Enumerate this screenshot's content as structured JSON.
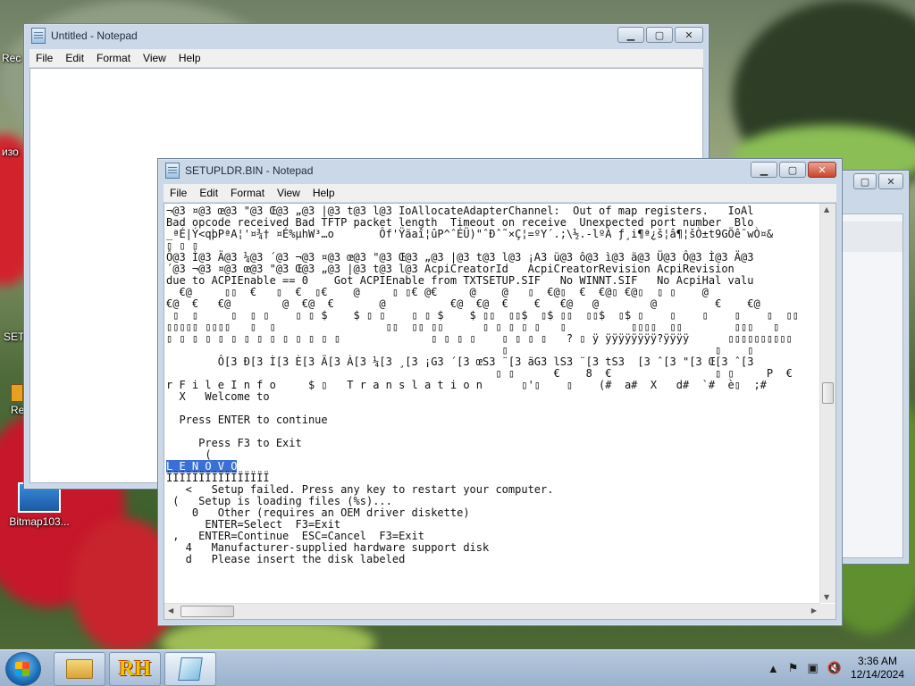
{
  "desktop": {
    "icons": [
      {
        "label": "Rec"
      },
      {
        "label": "изо"
      },
      {
        "label": "SET"
      },
      {
        "label": "Re"
      },
      {
        "label": "Bitmap103..."
      }
    ]
  },
  "notepad_back": {
    "title": "Untitled - Notepad",
    "menu": [
      "File",
      "Edit",
      "Format",
      "View",
      "Help"
    ]
  },
  "notepad_front": {
    "title": "SETUPLDR.BIN - Notepad",
    "menu": [
      "File",
      "Edit",
      "Format",
      "View",
      "Help"
    ],
    "lines": [
      "¬@3 ¤@3 œ@3 \"@3 Œ@3 „@3 |@3 t@3 l@3 IoAllocateAdapterChannel:  Out of map registers.   IoAl",
      "Bad opcode received Bad TFTP packet length  Timeout on receive  Unexpected port number  Blo",
      "_ªÉ|Ý<qþPªA¦'¤¾† ¤É%µhW³…o       Ôf'Ÿäaî¦ûP^ˆÉÜ)\"ˆÐˆ˜×Ç¦=ºY´.;\\½.-lºÀ ƒ¸i¶ª¿š¦â¶¦šÒ±t9GÖê¯wÒ¤&",
      "▯ ▯ ▯",
      "Ô@3 Ì@3 Ä@3 ¼@3 ´@3 ¬@3 ¤@3 œ@3 \"@3 Œ@3 „@3 |@3 t@3 l@3 ¡A3 ü@3 ô@3 ì@3 ä@3 Ü@3 Ô@3 Ì@3 Ä@3",
      "´@3 ¬@3 ¤@3 œ@3 \"@3 Œ@3 „@3 |@3 t@3 l@3 AcpiCreatorId   AcpiCreatorRevision AcpiRevision",
      "due to ACPIEnable == 0    Got ACPIEnable from TXTSETUP.SIF   No WINNT.SIF   No AcpiHal valu",
      "  €@     ▯▯  €   ▯  €  ▯€    @     ▯ ▯€ @€     @    @   ▯  €@▯  €  €@▯ €@▯  ▯ ▯    @",
      "€@  €   €@        @  €@  €       @          €@  €@  €    €   €@   @        @         €    €@",
      " ▯  ▯     ▯  ▯ ▯    ▯ ▯ $    $ ▯ ▯    ▯ ▯ $    $ ▯▯  ▯▯$  ▯$ ▯▯  ▯▯$  ▯$ ▯    ▯    ▯    ▯    ▯  ▯▯",
      "▯▯▯▯▯ ▯▯▯▯   ▯  ▯                 ▯▯  ▯▯ ▯▯      ▯ ▯ ▯ ▯ ▯   ▯          ▯▯▯▯  ▯▯        ▯▯▯   ▯",
      "▯ ▯ ▯ ▯ ▯ ▯ ▯ ▯ ▯ ▯ ▯ ▯ ▯ ▯              ▯ ▯ ▯ ▯    ▯ ▯ ▯ ▯   ? ▯ ÿ ÿÿÿÿÿÿÿÿ?ÿÿÿÿ      ▯▯▯▯▯▯▯▯▯▯",
      "                                                    ▯                                ▯    ▯",
      "        Ô[3 Ð[3 Ì[3 È[3 Ä[3 À[3 ¼[3 ¸[3 ¡G3 ´[3 œS3 ¨[3 äG3 lS3 ¨[3 tS3  [3 ˆ[3 \"[3 Œ[3 ˆ[3",
      "                                                   ▯ ▯      €    8  €                ▯ ▯     P  €",
      "r F i l e I n f o     $ ▯   T r a n s l a t i o n      ▯'▯    ▯    (#  a#  X   d#  `#  è▯  ;#",
      "  X   Welcome to",
      "",
      "  Press ENTER to continue",
      "",
      "     Press F3 to Exit",
      "      (",
      "L E N O V O",
      "ÏÏÏÏÏÏÏÏÏÏÏÏÏÏÏÏ",
      "   <   Setup failed. Press any key to restart your computer.",
      " (   Setup is loading files (%s)...",
      "    0   Other (requires an OEM driver diskette)",
      "      ENTER=Select  F3=Exit",
      " ,   ENTER=Continue  ESC=Cancel  F3=Exit",
      "   4   Manufacturer-supplied hardware support disk",
      "   d   Please insert the disk labeled"
    ],
    "selected_text": "L E N O V O"
  },
  "third_window": {},
  "taskbar": {
    "time": "3:36 AM",
    "date": "12/14/2024",
    "apps": [
      {
        "name": "file-explorer"
      },
      {
        "name": "rh-resource-hacker",
        "label": "RH"
      },
      {
        "name": "notepad"
      }
    ]
  }
}
